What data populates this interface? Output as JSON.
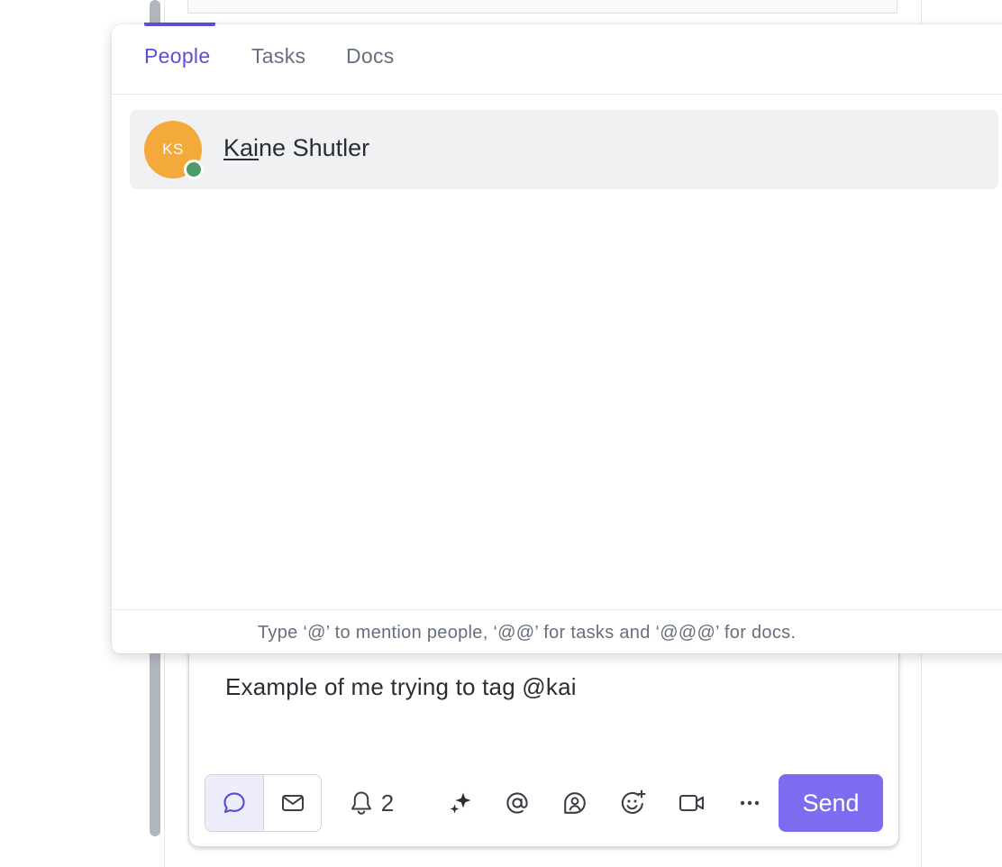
{
  "popup": {
    "tabs": [
      {
        "label": "People",
        "active": true
      },
      {
        "label": "Tasks",
        "active": false
      },
      {
        "label": "Docs",
        "active": false
      }
    ],
    "results": [
      {
        "initials": "KS",
        "name_match": "Kai",
        "name_rest": "ne Shutler",
        "avatar_color": "#f4a93b",
        "status": "online"
      }
    ],
    "footer_hint": "Type ‘@’ to mention people, ‘@@’ for tasks and ‘@@@’ for docs."
  },
  "composer": {
    "text": "Example of me trying to tag @kai",
    "toolbar": {
      "modes": [
        {
          "icon": "comment-icon",
          "active": true
        },
        {
          "icon": "email-icon",
          "active": false
        }
      ],
      "notification_count": "2",
      "icons": [
        "bell-icon",
        "ai-sparkle-icon",
        "mention-icon",
        "assign-user-icon",
        "emoji-add-icon",
        "video-icon",
        "more-icon"
      ],
      "send_label": "Send"
    }
  },
  "colors": {
    "accent": "#5b4fd6",
    "send_button": "#7b6cf0",
    "presence_online": "#4e9a68"
  }
}
